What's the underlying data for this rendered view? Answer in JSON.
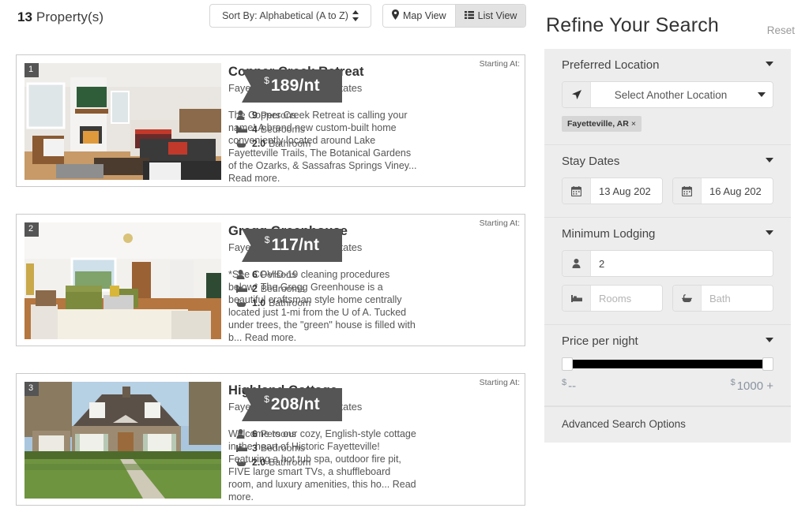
{
  "toolbar": {
    "count_number": "13",
    "count_label": " Property(s)",
    "sort_label": "Sort By: Alphabetical (A to Z)",
    "map_view_label": "Map View",
    "list_view_label": "List View",
    "active_view": "List View"
  },
  "properties": [
    {
      "index": "1",
      "title": "Copper Creek Retreat",
      "location": "Fayetteville, AR United States",
      "description": "The Copper Creek Retreat is calling your name! A brand new custom-built home conveniently located around Lake Fayetteville Trails, The Botanical Gardens of the Ozarks, & Sassafras Springs Viney... Read more.",
      "starting_at_label": "Starting At:",
      "currency": "$",
      "price": "189",
      "price_unit": "/nt",
      "persons_count": "9",
      "persons_label": "Persons",
      "bedrooms_count": "4",
      "bedrooms_label": "Bedrooms",
      "bathroom_count": "2.0",
      "bathroom_label": "Bathroom",
      "image_kind": "living-room-fireplace"
    },
    {
      "index": "2",
      "title": "Gregg Greenhouse",
      "location": "Fayetteville, AR United States",
      "description": "*See COVID-19 cleaning procedures below* The Gregg Greenhouse is a beautiful craftsman style home centrally located just 1-mi from the U of A. Tucked under trees, the \"green\" house is filled with b... Read more.",
      "starting_at_label": "Starting At:",
      "currency": "$",
      "price": "117",
      "price_unit": "/nt",
      "persons_count": "6",
      "persons_label": "Persons",
      "bedrooms_count": "2",
      "bedrooms_label": "Bedrooms",
      "bathroom_count": "1.0",
      "bathroom_label": "Bathroom",
      "image_kind": "living-room-green-sofa"
    },
    {
      "index": "3",
      "title": "Highland Cottage",
      "location": "Fayetteville, AR United States",
      "description": "Welcome to our cozy, English-style cottage in the heart of Historic Fayetteville! Featuring a hot tub spa, outdoor fire pit, FIVE large smart TVs, a shuffleboard room, and luxury amenities, this ho... Read more.",
      "starting_at_label": "Starting At:",
      "currency": "$",
      "price": "208",
      "price_unit": "/nt",
      "persons_count": "6",
      "persons_label": "Persons",
      "bedrooms_count": "3",
      "bedrooms_label": "Bedrooms",
      "bathroom_count": "2.0",
      "bathroom_label": "Bathroom",
      "image_kind": "stone-cottage-exterior"
    }
  ],
  "sidebar": {
    "title": "Refine Your Search",
    "reset_label": "Reset",
    "location_section": {
      "title": "Preferred Location",
      "select_label": "Select Another Location",
      "chip_label": "Fayetteville, AR",
      "chip_close": "×"
    },
    "stay_dates_section": {
      "title": "Stay Dates",
      "checkin_value": "13 Aug 202",
      "checkout_value": "16 Aug 202"
    },
    "lodging_section": {
      "title": "Minimum Lodging",
      "guests_value": "2",
      "rooms_placeholder": "Rooms",
      "bath_placeholder": "Bath"
    },
    "price_section": {
      "title": "Price per night",
      "min_currency": "$",
      "min_value": "--",
      "max_currency": "$",
      "max_value": "1000 +"
    },
    "advanced_label": "Advanced Search Options"
  },
  "colors": {
    "ribbon": "#555555",
    "panel_bg": "#ededed",
    "slider_track": "#000000"
  }
}
